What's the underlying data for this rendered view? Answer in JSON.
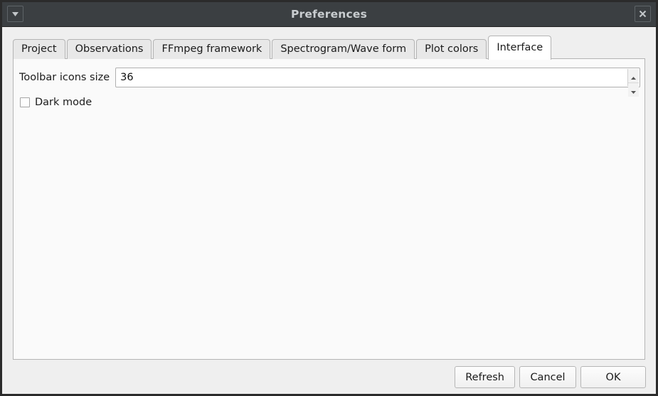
{
  "window": {
    "title": "Preferences",
    "menu_button_icon": "triangle-down-icon",
    "close_button_icon": "close-icon"
  },
  "tabs": [
    {
      "label": "Project",
      "selected": false
    },
    {
      "label": "Observations",
      "selected": false
    },
    {
      "label": "FFmpeg framework",
      "selected": false
    },
    {
      "label": "Spectrogram/Wave form",
      "selected": false
    },
    {
      "label": "Plot colors",
      "selected": false
    },
    {
      "label": "Interface",
      "selected": true
    }
  ],
  "interface_panel": {
    "toolbar_icons_size": {
      "label": "Toolbar icons size",
      "value": "36",
      "spin_up_icon": "triangle-up-icon",
      "spin_down_icon": "triangle-down-icon"
    },
    "dark_mode": {
      "label": "Dark mode",
      "checked": false
    }
  },
  "buttons": {
    "refresh": "Refresh",
    "cancel": "Cancel",
    "ok": "OK"
  },
  "colors": {
    "titlebar_bg": "#3b3f42",
    "title_text": "#c9cdd0",
    "dialog_bg": "#efefef",
    "panel_bg": "#fafafa",
    "tab_bg": "#e8e8e8",
    "tab_selected_bg": "#ffffff",
    "border": "#b4b4b4"
  }
}
